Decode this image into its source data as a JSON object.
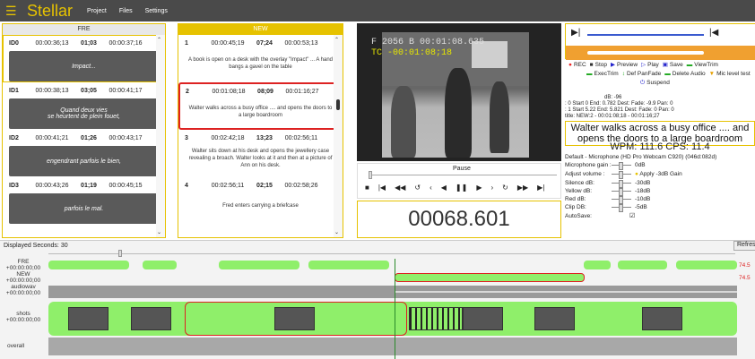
{
  "app": {
    "brand": "Stellar",
    "menu": [
      "Project",
      "Files",
      "Settings"
    ]
  },
  "fre": {
    "header": "FRE",
    "segments": [
      {
        "id": "ID0",
        "start": "00:00:36;13",
        "dur": "01;03",
        "end": "00:00:37;16",
        "text": "Impact..."
      },
      {
        "id": "ID1",
        "start": "00:00:38;13",
        "dur": "03;05",
        "end": "00:00:41;17",
        "text": "Quand deux vies\nse heurtent de plein fouet,"
      },
      {
        "id": "ID2",
        "start": "00:00:41;21",
        "dur": "01;26",
        "end": "00:00:43;17",
        "text": "engendrant parfois le bien,"
      },
      {
        "id": "ID3",
        "start": "00:00:43;26",
        "dur": "01;19",
        "end": "00:00:45;15",
        "text": "parfois le mal."
      }
    ]
  },
  "new": {
    "header": "NEW",
    "segments": [
      {
        "id": "1",
        "start": "00:00:45;19",
        "dur": "07;24",
        "end": "00:00:53;13",
        "text": "A book is open on a desk with the overlay \"Impact\" ... A hand bangs a gavel on the table"
      },
      {
        "id": "2",
        "start": "00:01:08;18",
        "dur": "08;09",
        "end": "00:01:16;27",
        "text": "Walter walks across a busy office .... and opens the doors to a large boardroom"
      },
      {
        "id": "3",
        "start": "00:02:42;18",
        "dur": "13;23",
        "end": "00:02:56;11",
        "text": "Walter sits down at his desk and opens  the jewellery case revealing a broach. Walter looks at it and then at a picture of Ann on his desk."
      },
      {
        "id": "4",
        "start": "00:02:56;11",
        "dur": "02;15",
        "end": "00:02:58;26",
        "text": "Fred enters carrying a briefcase"
      }
    ]
  },
  "video": {
    "osd_line1": "F 2056 B  00:01:08.635",
    "osd_line2": "TC -00:01:08;18"
  },
  "transport": {
    "status": "Pause",
    "frame": "00068.601"
  },
  "right": {
    "buttons_row1": [
      {
        "icon": "record-icon",
        "label": "REC"
      },
      {
        "icon": "stop-icon",
        "label": "Stop"
      },
      {
        "icon": "preview-icon",
        "label": "Preview"
      },
      {
        "icon": "play-icon",
        "label": "Play"
      },
      {
        "icon": "save-icon",
        "label": "Save"
      },
      {
        "icon": "viewtrim-icon",
        "label": "ViewTrim"
      }
    ],
    "buttons_row2": [
      {
        "icon": "exectrim-icon",
        "label": "ExecTrim"
      },
      {
        "icon": "panfade-icon",
        "label": "Def PanFade"
      },
      {
        "icon": "delete-audio-icon",
        "label": "Delete Audio"
      },
      {
        "icon": "mic-icon",
        "label": "Mic level test"
      }
    ],
    "buttons_row3": [
      {
        "icon": "suspend-icon",
        "label": "Suspend"
      }
    ],
    "db_line": "dB: -96",
    "info1": ": 0 Start 0 End: 0.782 Dest: Fade: -9.9 Pan: 0",
    "info2": ": 1 Start 5.22 End: 5.821 Dest: Fade: 0 Pan: 0",
    "title_line": "title: NEW:2 - 00:01:08;18 - 00:01:16;27",
    "caption": "Walter walks across a busy office .... and opens the doors to a large boardroom",
    "wpm": "WPM: 111.6 CPS: 11.4",
    "mic": "Default - Microphone (HD Pro Webcam C920) (046d:082d)",
    "gain_label": "Microphone gain :",
    "gain_value": "0dB",
    "adjust_label": "Adjust volume :",
    "apply_label": "Apply -3dB Gain",
    "silence_label": "Silence dB:",
    "silence_value": "-30dB",
    "yellow_label": "Yellow dB:",
    "yellow_value": "-18dB",
    "red_label": "Red dB:",
    "red_value": "-10dB",
    "clip_label": "Clip DB:",
    "clip_value": "-5dB",
    "autosave_label": "AutoSave:"
  },
  "timeline": {
    "displayed": "Displayed Seconds: 30",
    "refresh": "Refresh",
    "tracks": [
      {
        "label": "FRE\n+00:00:00;00",
        "pct": "74.5"
      },
      {
        "label": "NEW\n+00:00:00;00",
        "pct": "74.5"
      },
      {
        "label": "audiowav\n+00:00:00;00",
        "pct": ""
      },
      {
        "label": "shots\n+00:00:00;00",
        "pct": ""
      },
      {
        "label": "overall",
        "pct": ""
      }
    ]
  }
}
